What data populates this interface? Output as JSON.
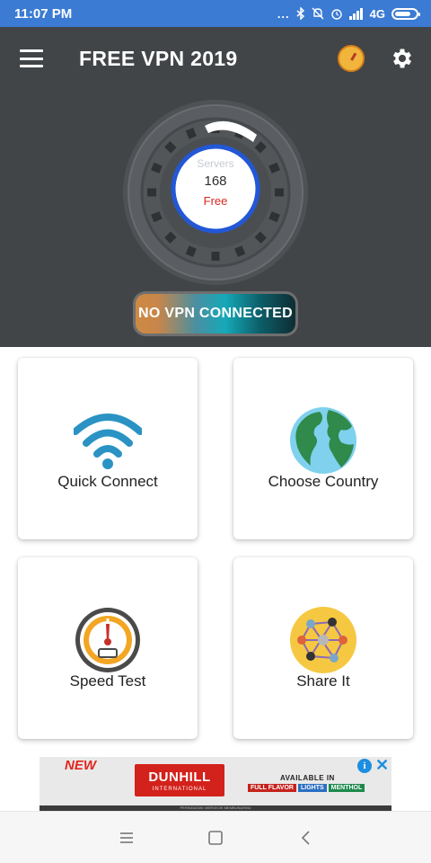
{
  "status_bar": {
    "time": "11:07 PM",
    "dots": "...",
    "network": "4G",
    "battery_level": 0.75
  },
  "app_bar": {
    "title": "FREE VPN 2019",
    "menu_icon": "hamburger-menu-icon",
    "speed_icon": "speedometer-icon",
    "settings_icon": "gear-icon"
  },
  "dial": {
    "servers_label": "Servers",
    "servers_count": "168",
    "tier_label": "Free"
  },
  "vpn_status": "NO VPN CONNECTED",
  "cards": [
    {
      "label": "Quick Connect",
      "icon": "wifi-icon"
    },
    {
      "label": "Choose Country",
      "icon": "globe-icon"
    },
    {
      "label": "Speed Test",
      "icon": "speedometer-icon"
    },
    {
      "label": "Share It",
      "icon": "share-network-icon"
    }
  ],
  "ad": {
    "new_label": "NEW",
    "brand": "DUNHILL",
    "brand_sub": "INTERNATIONAL",
    "available": "AVAILABLE IN",
    "tags": [
      "FULL FLAVOR",
      "LIGHTS",
      "MENTHOL"
    ],
    "info_icon": "i",
    "close_icon": "✕",
    "footnote": "PERINGATAN: MEROKOK MEMBUNUHMU"
  },
  "nav": {
    "menu_icon": "recents-icon",
    "home_icon": "home-icon",
    "back_icon": "back-icon"
  },
  "colors": {
    "status_bar": "#3b7bd3",
    "header_bg": "#424548",
    "accent_blue": "#2258d6",
    "free_red": "#d8281f"
  }
}
